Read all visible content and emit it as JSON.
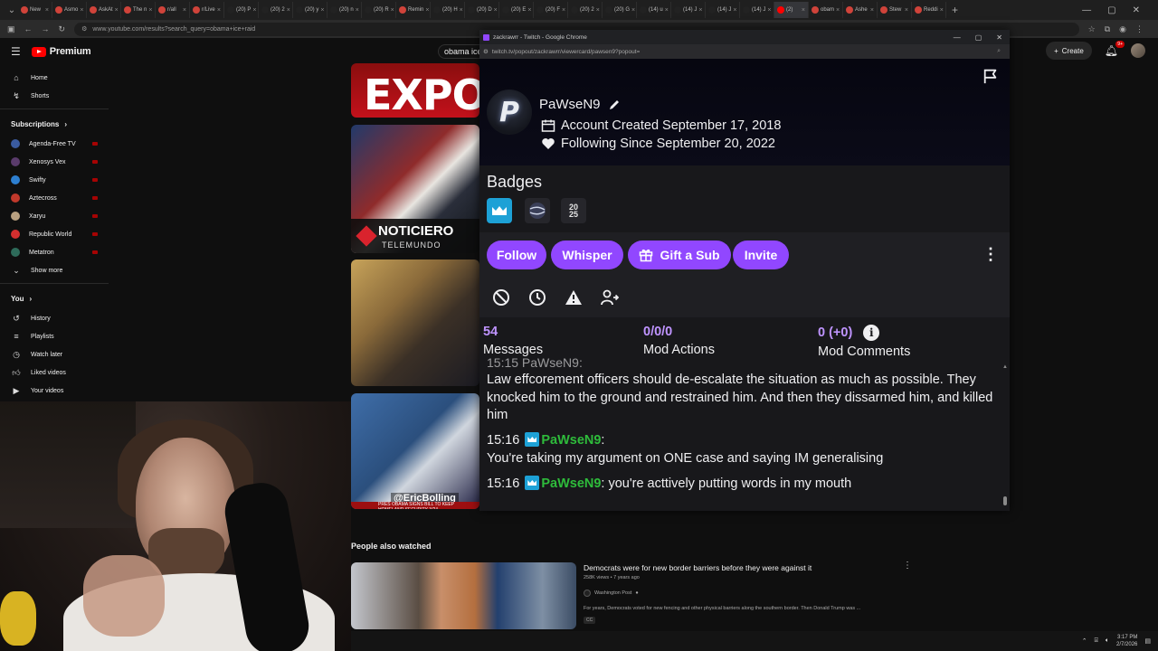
{
  "browser": {
    "tabs": [
      "New",
      "Asmo",
      "AskAt",
      "The n",
      "r/all",
      "r/Live",
      "(20) P",
      "(20) 2",
      "(20) y",
      "(20) n",
      "(20) R",
      "Remin",
      "(20) H",
      "(20) D",
      "(20) E",
      "(20) F",
      "(20) 2",
      "(20) G",
      "(14) u",
      "(14) J",
      "(14) J",
      "(14) J",
      "(2) ",
      "obam",
      "Ashe",
      "Stew",
      "Reddi"
    ],
    "active_tab_index": 22,
    "address": "www.youtube.com/results?search_query=obama+ice+raid"
  },
  "youtube": {
    "brand": "Premium",
    "search_value": "obama ice r",
    "create_label": "Create",
    "notif_count": "9+",
    "nav": [
      {
        "icon": "home-icon",
        "label": "Home"
      },
      {
        "icon": "shorts-icon",
        "label": "Shorts"
      }
    ],
    "subscriptions_label": "Subscriptions",
    "subscriptions": [
      {
        "label": "Agenda-Free TV",
        "color": "#3a5ba0"
      },
      {
        "label": "Xenosys Vex",
        "color": "#5a3b6b"
      },
      {
        "label": "Swifty",
        "color": "#2d7fd0"
      },
      {
        "label": "Aztecross",
        "color": "#c0392b"
      },
      {
        "label": "Xaryu",
        "color": "#b8a080"
      },
      {
        "label": "Republic World",
        "color": "#d32f2f"
      },
      {
        "label": "Metatron",
        "color": "#2e6b5a"
      }
    ],
    "show_more_label": "Show more",
    "you_label": "You",
    "you_items": [
      {
        "icon": "history-icon",
        "label": "History"
      },
      {
        "icon": "playlists-icon",
        "label": "Playlists"
      },
      {
        "icon": "watch-later-icon",
        "label": "Watch later"
      },
      {
        "icon": "liked-icon",
        "label": "Liked videos"
      },
      {
        "icon": "your-videos-icon",
        "label": "Your videos"
      }
    ],
    "thumb1_text": "EXPO",
    "thumb2_text1": "NOTICIERO",
    "thumb2_text2": "TELEMUNDO",
    "thumb4_handle": "@EricBolling",
    "thumb4_ticker": "PRES OBAMA SIGNS BILL TO KEEP HOMELAND SECURITY 3/24",
    "people_also_watched": "People also watched",
    "pa_video": {
      "title": "Democrats were for new border barriers before they were against it",
      "meta": "258K views • 7 years ago",
      "channel": "Washington Post",
      "desc": "For years, Democrats voted for new fencing and other physical barriers along the southern border. Then Donald Trump was ...",
      "cc": "CC"
    }
  },
  "taskbar": {
    "time": "3:17 PM",
    "date": "2/7/2026"
  },
  "twitch": {
    "window_title": "zackrawrr - Twitch - Google Chrome",
    "url": "twitch.tv/popout/zackrawrr/viewercard/pawsen9?popout=",
    "username": "PaWseN9",
    "account_created": "Account Created September 17, 2018",
    "following_since": "Following Since September 20, 2022",
    "badges_title": "Badges",
    "badge3_line1": "20",
    "badge3_line2": "25",
    "buttons": {
      "follow": "Follow",
      "whisper": "Whisper",
      "gift": "Gift a Sub",
      "invite": "Invite"
    },
    "stats": [
      {
        "num": "54",
        "label": "Messages"
      },
      {
        "num": "0/0/0",
        "label": "Mod Actions"
      },
      {
        "num": "0 (+0)",
        "label": "Mod Comments"
      }
    ],
    "chat_cut": "15:15 PaWseN9:",
    "messages": [
      {
        "time": "",
        "name": "",
        "text": "Law effcorement officers should de-escalate the situation as much as possible. They knocked him to the ground and restrained him. And then they dissarmed him, and killed him"
      },
      {
        "time": "15:16",
        "name": "PaWseN9",
        "text": "You're taking my argument on ONE case and saying IM generalising"
      },
      {
        "time": "15:16",
        "name": "PaWseN9",
        "text": "you're acttively putting words in my mouth"
      }
    ]
  }
}
